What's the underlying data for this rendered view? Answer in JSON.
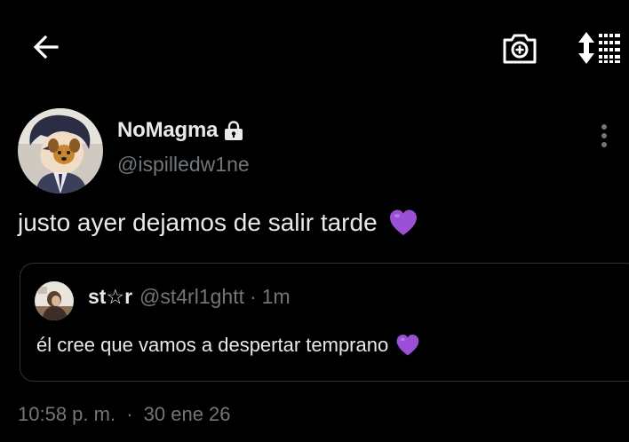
{
  "header": {
    "back_icon": "arrow-left-icon",
    "camera_icon": "camera-plus-icon",
    "sort_icon": "sort-list-icon"
  },
  "tweet": {
    "display_name": "NoMagma",
    "protected_icon": "lock-icon",
    "handle": "@ispilledw1ne",
    "text": "justo ayer dejamos de salir tarde",
    "emoji": "purple-heart",
    "timestamp": "10:58 p. m.",
    "separator": "·",
    "date": "30 ene 26"
  },
  "quoted_tweet": {
    "display_name": "st☆r",
    "handle": "@st4rl1ghtt",
    "separator": "·",
    "relative_time": "1m",
    "text": "él cree que vamos a despertar temprano",
    "emoji": "purple-heart"
  },
  "colors": {
    "background": "#000000",
    "primary_text": "#e7e9ea",
    "secondary_text": "#71767b",
    "border": "#2f3336",
    "heart": "#9b4fd6"
  }
}
